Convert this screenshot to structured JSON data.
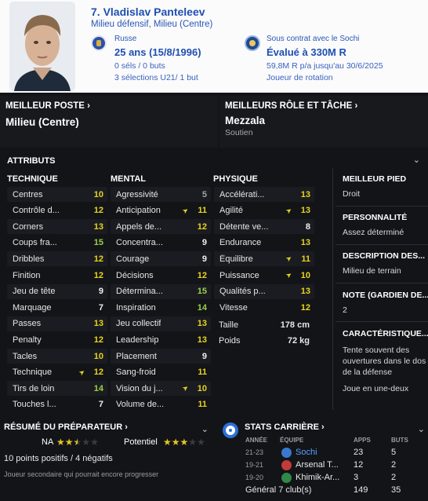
{
  "player": {
    "name": "7. Vladislav Panteleev",
    "position": "Milieu défensif, Milieu (Centre)",
    "nationality": "Russe",
    "age": "25 ans (15/8/1996)",
    "caps": "0 séls / 0 buts",
    "u21": "3 sélections U21/ 1 but",
    "contract": "Sous contrat avec le Sochi",
    "value": "Évalué à 330M R",
    "wage": "59,8M R p/a jusqu'au 30/6/2025",
    "squad_role": "Joueur de rotation"
  },
  "best_position": {
    "title": "MEILLEUR POSTE",
    "value": "Milieu (Centre)"
  },
  "best_role": {
    "title": "MEILLEURS RÔLE ET TÂCHE",
    "value": "Mezzala",
    "duty": "Soutien"
  },
  "attributes": {
    "title": "ATTRIBUTS",
    "technique": {
      "title": "TECHNIQUE",
      "items": [
        {
          "name": "Centres",
          "value": "10"
        },
        {
          "name": "Contrôle d...",
          "value": "12"
        },
        {
          "name": "Corners",
          "value": "13"
        },
        {
          "name": "Coups fra...",
          "value": "15"
        },
        {
          "name": "Dribbles",
          "value": "12"
        },
        {
          "name": "Finition",
          "value": "12"
        },
        {
          "name": "Jeu de tête",
          "value": "9"
        },
        {
          "name": "Marquage",
          "value": "7"
        },
        {
          "name": "Passes",
          "value": "13"
        },
        {
          "name": "Penalty",
          "value": "12"
        },
        {
          "name": "Tacles",
          "value": "10"
        },
        {
          "name": "Technique",
          "value": "12"
        },
        {
          "name": "Tirs de loin",
          "value": "14"
        },
        {
          "name": "Touches l...",
          "value": "7"
        }
      ]
    },
    "mental": {
      "title": "MENTAL",
      "items": [
        {
          "name": "Agressivité",
          "value": "5"
        },
        {
          "name": "Anticipation",
          "value": "11"
        },
        {
          "name": "Appels de...",
          "value": "12"
        },
        {
          "name": "Concentra...",
          "value": "9"
        },
        {
          "name": "Courage",
          "value": "9"
        },
        {
          "name": "Décisions",
          "value": "12"
        },
        {
          "name": "Détermina...",
          "value": "15"
        },
        {
          "name": "Inspiration",
          "value": "14"
        },
        {
          "name": "Jeu collectif",
          "value": "13"
        },
        {
          "name": "Leadership",
          "value": "13"
        },
        {
          "name": "Placement",
          "value": "9"
        },
        {
          "name": "Sang-froid",
          "value": "11"
        },
        {
          "name": "Vision du j...",
          "value": "10"
        },
        {
          "name": "Volume de...",
          "value": "11"
        }
      ]
    },
    "physique": {
      "title": "PHYSIQUE",
      "items": [
        {
          "name": "Accélérati...",
          "value": "13"
        },
        {
          "name": "Agilité",
          "value": "13"
        },
        {
          "name": "Détente ve...",
          "value": "8"
        },
        {
          "name": "Endurance",
          "value": "13"
        },
        {
          "name": "Équilibre",
          "value": "11"
        },
        {
          "name": "Puissance",
          "value": "10"
        },
        {
          "name": "Qualités p...",
          "value": "13"
        },
        {
          "name": "Vitesse",
          "value": "12"
        }
      ],
      "height_label": "Taille",
      "height": "178 cm",
      "weight_label": "Poids",
      "weight": "72 kg"
    }
  },
  "info": {
    "foot_title": "MEILLEUR PIED",
    "foot": "Droit",
    "personality_title": "PERSONNALITÉ",
    "personality": "Assez déterminé",
    "desc_title": "DESCRIPTION DES...",
    "desc": "Milieu de terrain",
    "gk_title": "NOTE (GARDIEN DE...",
    "gk": "2",
    "traits_title": "CARACTÉRISTIQUE...",
    "traits": "Tente souvent des ouvertures dans le dos de la défense",
    "traits2": "Joue en une-deux"
  },
  "coach": {
    "title": "RÉSUMÉ DU PRÉPARATEUR",
    "ability_label": "NA",
    "ability_stars": 2.5,
    "potential_label": "Potentiel",
    "potential_stars": 3,
    "summary": "10 points positifs / 4 négatifs",
    "note": "Joueur secondaire qui pourrait encore progresser"
  },
  "career": {
    "title": "STATS CARRIÈRE",
    "headers": [
      "ANNÉE",
      "ÉQUIPE",
      "APPS",
      "BUTS"
    ],
    "rows": [
      {
        "year": "21-23",
        "team": "Sochi",
        "apps": "23",
        "goals": "5"
      },
      {
        "year": "19-21",
        "team": "Arsenal T...",
        "apps": "12",
        "goals": "2"
      },
      {
        "year": "19-20",
        "team": "Khimik-Ar...",
        "apps": "3",
        "goals": "2"
      }
    ],
    "total_label": "Général 7 club(s)",
    "total_apps": "149",
    "total_goals": "35"
  },
  "colors": {
    "yellow": "#e8d41e",
    "green": "#9ad04a",
    "header_blue": "#1f4fb3"
  }
}
